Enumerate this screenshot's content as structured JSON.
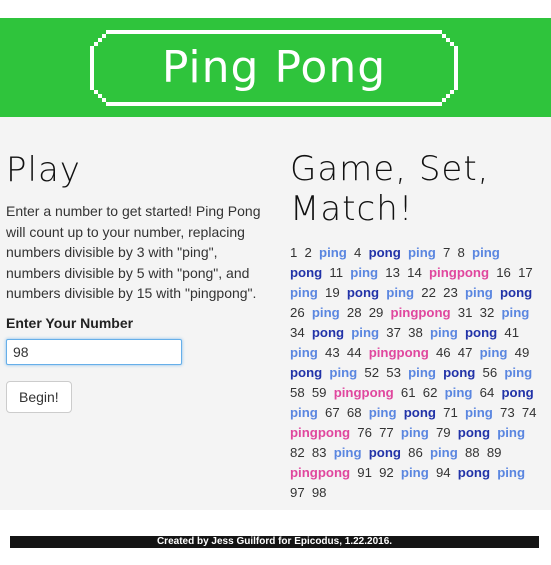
{
  "header": {
    "logo_text": "Ping Pong",
    "bg_color": "#2fc43c"
  },
  "play": {
    "title": "Play",
    "intro": "Enter a number to get started! Ping Pong will count up to your number, replacing numbers divisible by 3 with \"ping\", numbers divisible by 5 with \"pong\", and numbers divisible by 15 with \"pingpong\".",
    "input_label": "Enter Your Number",
    "input_value": "98",
    "button_label": "Begin!"
  },
  "results": {
    "title": "Game, Set, Match!",
    "colors": {
      "ping": "#5a86e0",
      "pong": "#2233a8",
      "pingpong": "#e0479e"
    },
    "items": [
      "1",
      "2",
      "ping",
      "4",
      "pong",
      "ping",
      "7",
      "8",
      "ping",
      "pong",
      "11",
      "ping",
      "13",
      "14",
      "pingpong",
      "16",
      "17",
      "ping",
      "19",
      "pong",
      "ping",
      "22",
      "23",
      "ping",
      "pong",
      "26",
      "ping",
      "28",
      "29",
      "pingpong",
      "31",
      "32",
      "ping",
      "34",
      "pong",
      "ping",
      "37",
      "38",
      "ping",
      "pong",
      "41",
      "ping",
      "43",
      "44",
      "pingpong",
      "46",
      "47",
      "ping",
      "49",
      "pong",
      "ping",
      "52",
      "53",
      "ping",
      "pong",
      "56",
      "ping",
      "58",
      "59",
      "pingpong",
      "61",
      "62",
      "ping",
      "64",
      "pong",
      "ping",
      "67",
      "68",
      "ping",
      "pong",
      "71",
      "ping",
      "73",
      "74",
      "pingpong",
      "76",
      "77",
      "ping",
      "79",
      "pong",
      "ping",
      "82",
      "83",
      "ping",
      "pong",
      "86",
      "ping",
      "88",
      "89",
      "pingpong",
      "91",
      "92",
      "ping",
      "94",
      "pong",
      "ping",
      "97",
      "98"
    ]
  },
  "footer": {
    "text": "Created by Jess Guilford for Epicodus, 1.22.2016."
  }
}
